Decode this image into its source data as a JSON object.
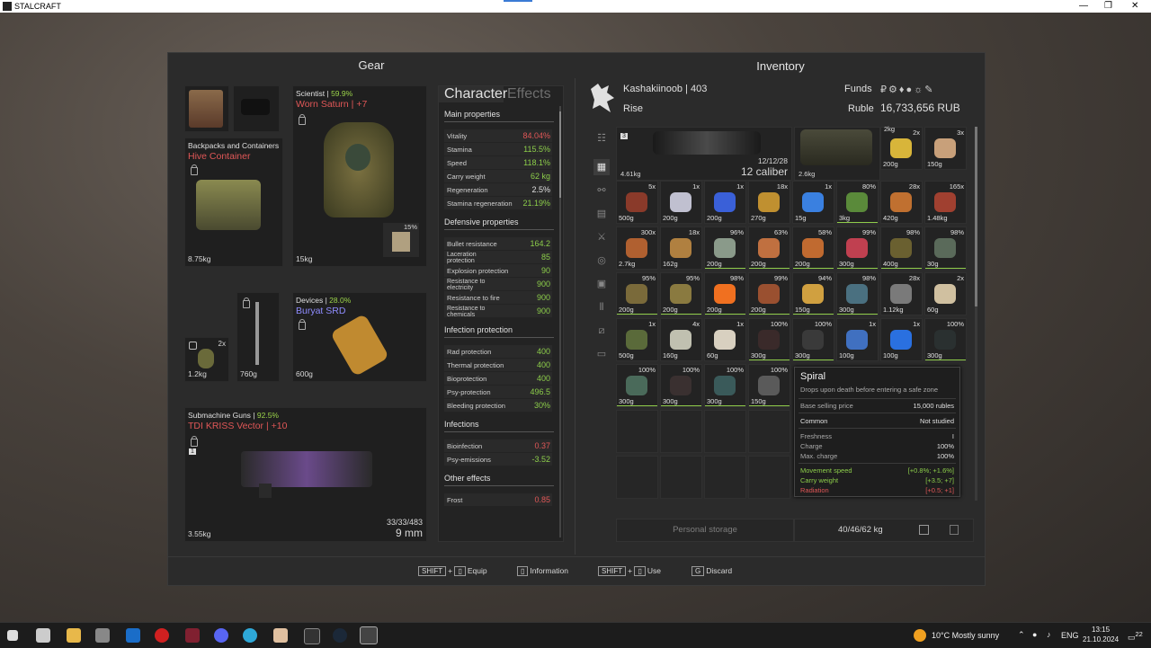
{
  "app_title": "STALCRAFT",
  "window_controls": {
    "minimize": "—",
    "restore": "❐",
    "close": "✕"
  },
  "gear": {
    "header": "Gear",
    "armor": {
      "label": "Scientist",
      "pct": "59.9%",
      "name": "Worn Saturn",
      "upgrade": "+7",
      "weight": "15kg",
      "sub_pct": "15%"
    },
    "backpack": {
      "label": "Backpacks and Containers",
      "name": "Hive Container",
      "weight": "8.75kg"
    },
    "device": {
      "label": "Devices",
      "pct": "28.0%",
      "name": "Buryat SRD",
      "weight": "600g"
    },
    "grenade": {
      "count": "2x",
      "weight": "1.2kg"
    },
    "melee": {
      "weight": "760g"
    },
    "weapon": {
      "label": "Submachine Guns",
      "pct": "92.5%",
      "name": "TDI KRISS Vector",
      "upgrade": "+10",
      "weight": "3.55kg",
      "ammo": "33/33/483",
      "caliber": "9 mm",
      "slot_num": "1"
    }
  },
  "stats": {
    "tab_character": "Character",
    "tab_effects": "Effects",
    "main_title": "Main properties",
    "main": [
      {
        "k": "Vitality",
        "v": "84.04%",
        "c": "r"
      },
      {
        "k": "Stamina",
        "v": "115.5%",
        "c": "g"
      },
      {
        "k": "Speed",
        "v": "118.1%",
        "c": "g"
      },
      {
        "k": "Carry weight",
        "v": "62 kg",
        "c": "g"
      },
      {
        "k": "Regeneration",
        "v": "2.5%",
        "c": "w"
      },
      {
        "k": "Stamina regeneration",
        "v": "21.19%",
        "c": "g"
      }
    ],
    "def_title": "Defensive properties",
    "def": [
      {
        "k": "Bullet resistance",
        "v": "164.2",
        "c": "g"
      },
      {
        "k": "Laceration protection",
        "v": "85",
        "c": "g"
      },
      {
        "k": "Explosion protection",
        "v": "90",
        "c": "g"
      },
      {
        "k": "Resistance to electricity",
        "v": "900",
        "c": "g"
      },
      {
        "k": "Resistance to fire",
        "v": "900",
        "c": "g"
      },
      {
        "k": "Resistance to chemicals",
        "v": "900",
        "c": "g"
      }
    ],
    "inf_title": "Infection protection",
    "inf": [
      {
        "k": "Rad protection",
        "v": "400",
        "c": "g"
      },
      {
        "k": "Thermal protection",
        "v": "400",
        "c": "g"
      },
      {
        "k": "Bioprotection",
        "v": "400",
        "c": "g"
      },
      {
        "k": "Psy-protection",
        "v": "496.5",
        "c": "g"
      },
      {
        "k": "Bleeding protection",
        "v": "30%",
        "c": "g"
      }
    ],
    "infections_title": "Infections",
    "infections": [
      {
        "k": "Bioinfection",
        "v": "0.37",
        "c": "r"
      },
      {
        "k": "Psy-emissions",
        "v": "-3.52",
        "c": "g"
      }
    ],
    "other_title": "Other effects",
    "other": [
      {
        "k": "Frost",
        "v": "0.85",
        "c": "r"
      }
    ]
  },
  "inventory": {
    "header": "Inventory",
    "player": "Kashakiinoob | 403",
    "faction": "Rise",
    "funds_label": "Funds",
    "funds_icons": "₽⚙♦●☼✎",
    "currency_label": "Ruble",
    "funds_value": "16,733,656 RUB",
    "big_items": [
      {
        "slot_num": "3",
        "ammo": "12/12/28",
        "caliber": "12 caliber",
        "weight": "4.61kg"
      },
      {
        "weight": "2.6kg"
      }
    ],
    "rows": [
      [
        {
          "q": "",
          "w": "2kg",
          "col": "#6b6b6b"
        },
        {
          "q": "2x",
          "w": "200g",
          "col": "#d8b53a"
        },
        {
          "q": "3x",
          "w": "150g",
          "col": "#c8a07a"
        }
      ],
      [
        {
          "q": "5x",
          "w": "500g",
          "col": "#8a3a2a"
        },
        {
          "q": "1x",
          "w": "200g",
          "col": "#c0c0d0"
        },
        {
          "q": "1x",
          "w": "200g",
          "col": "#3a60d8"
        },
        {
          "q": "18x",
          "w": "270g",
          "col": "#c09030"
        },
        {
          "q": "1x",
          "w": "15g",
          "col": "#3a80e0"
        },
        {
          "q": "80%",
          "w": "3kg",
          "col": "#5a8a3a"
        },
        {
          "q": "28x",
          "w": "420g",
          "col": "#c07030"
        },
        {
          "q": "165x",
          "w": "1.48kg",
          "col": "#a04030"
        }
      ],
      [
        {
          "q": "300x",
          "w": "2.7kg",
          "col": "#b06030"
        },
        {
          "q": "18x",
          "w": "162g",
          "col": "#b08040"
        },
        {
          "q": "96%",
          "w": "200g",
          "col": "#8a9a8a"
        },
        {
          "q": "63%",
          "w": "200g",
          "col": "#c07040"
        },
        {
          "q": "58%",
          "w": "200g",
          "col": "#c06a30"
        },
        {
          "q": "99%",
          "w": "300g",
          "col": "#c04050"
        },
        {
          "q": "98%",
          "w": "400g",
          "col": "#6a6030"
        },
        {
          "q": "98%",
          "w": "30g",
          "col": "#5a6a5a"
        }
      ],
      [
        {
          "q": "95%",
          "w": "200g",
          "col": "#7a6a3a"
        },
        {
          "q": "95%",
          "w": "200g",
          "col": "#8a7a40"
        },
        {
          "q": "98%",
          "w": "200g",
          "col": "#f07020"
        },
        {
          "q": "99%",
          "w": "200g",
          "col": "#9a5030"
        },
        {
          "q": "94%",
          "w": "150g",
          "col": "#d0a040"
        },
        {
          "q": "98%",
          "w": "300g",
          "col": "#4a7080"
        },
        {
          "q": "28x",
          "w": "1.12kg",
          "col": "#7a7a7a"
        },
        {
          "q": "2x",
          "w": "60g",
          "col": "#d0c0a0"
        }
      ],
      [
        {
          "q": "1x",
          "w": "500g",
          "col": "#5a6a3a"
        },
        {
          "q": "4x",
          "w": "160g",
          "col": "#c0c0b0"
        },
        {
          "q": "1x",
          "w": "60g",
          "col": "#d8d0c0"
        },
        {
          "q": "100%",
          "w": "300g",
          "col": "#3a2a2a"
        },
        {
          "q": "100%",
          "w": "300g",
          "col": "#3a3a3a"
        },
        {
          "q": "1x",
          "w": "100g",
          "col": "#4070c0"
        },
        {
          "q": "1x",
          "w": "100g",
          "col": "#2a70e0"
        },
        {
          "q": "100%",
          "w": "300g",
          "col": "#2a3030"
        }
      ],
      [
        {
          "q": "100%",
          "w": "300g",
          "col": "#4a6a5a"
        },
        {
          "q": "100%",
          "w": "300g",
          "col": "#3a3030"
        },
        {
          "q": "100%",
          "w": "300g",
          "col": "#3a5a5a"
        },
        {
          "q": "100%",
          "w": "150g",
          "col": "#5a5a5a"
        }
      ]
    ],
    "storage_label": "Personal storage",
    "storage_weight": "40/46/62 kg"
  },
  "tooltip": {
    "title": "Spiral",
    "desc": "Drops upon death before entering a safe zone",
    "price_label": "Base selling price",
    "price": "15,000 rubles",
    "rarity": "Common",
    "study": "Not studied",
    "freshness_label": "Freshness",
    "freshness": "I",
    "charge_label": "Charge",
    "charge": "100%",
    "maxcharge_label": "Max. charge",
    "maxcharge": "100%",
    "effects": [
      {
        "k": "Movement speed",
        "v": "[+0.8%; +1.6%]",
        "c": "#8ccd4a"
      },
      {
        "k": "Carry weight",
        "v": "[+3.5; +7]",
        "c": "#8ccd4a"
      },
      {
        "k": "Radiation",
        "v": "[+0.5; +1]",
        "c": "#e05757"
      }
    ]
  },
  "footer": {
    "shift": "SHIFT",
    "plus": "+",
    "equip": "Equip",
    "information": "Information",
    "use": "Use",
    "g_key": "G",
    "discard": "Discard"
  },
  "taskbar": {
    "weather": "10°C  Mostly sunny",
    "lang": "ENG",
    "time": "13:15",
    "date": "21.10.2024",
    "notif": "22"
  }
}
